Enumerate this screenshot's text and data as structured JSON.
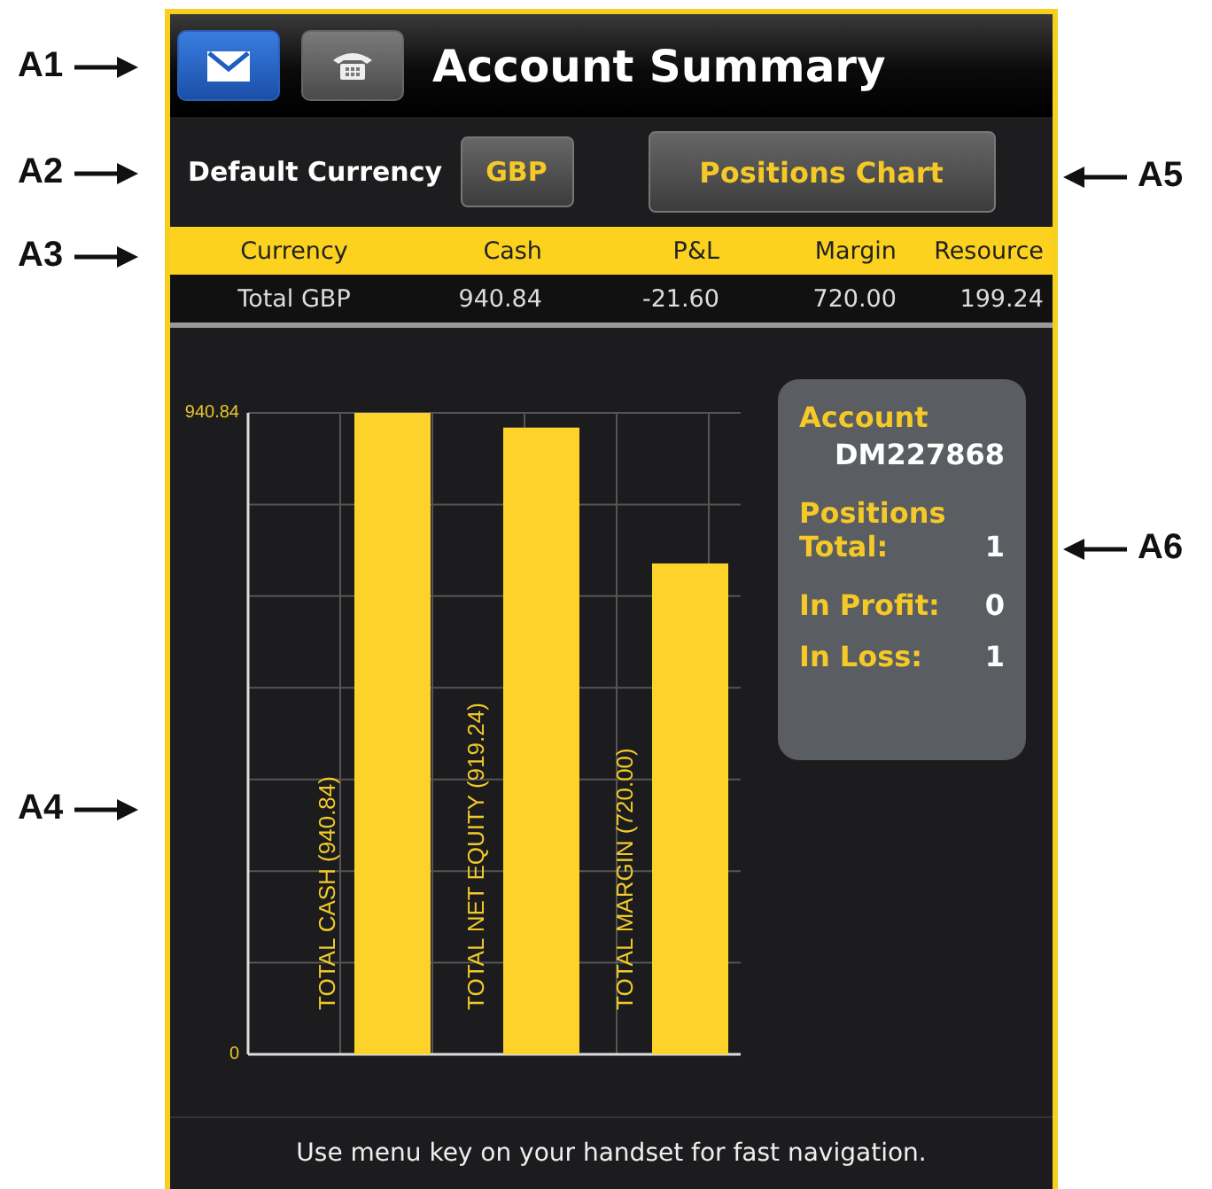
{
  "callouts_left": [
    "A1",
    "A2",
    "A3",
    "A4"
  ],
  "callouts_right": [
    "A5",
    "A6"
  ],
  "header": {
    "title": "Account Summary",
    "buttons": [
      {
        "kind": "mail",
        "selected": true
      },
      {
        "kind": "phone",
        "selected": false
      }
    ]
  },
  "currency_bar": {
    "label": "Default Currency",
    "currency_button": "GBP",
    "chart_button": "Positions Chart"
  },
  "table": {
    "columns": [
      "Currency",
      "Cash",
      "P&L",
      "Margin",
      "Resource"
    ],
    "rows": [
      [
        "Total GBP",
        "940.84",
        "-21.60",
        "720.00",
        "199.24"
      ]
    ]
  },
  "chart_data": {
    "type": "bar",
    "categories": [
      "TOTAL CASH (940.84)",
      "TOTAL NET EQUITY (919.24)",
      "TOTAL MARGIN (720.00)"
    ],
    "values": [
      940.84,
      919.24,
      720.0
    ],
    "ylim": [
      0,
      940.84
    ],
    "yticks": [
      {
        "value": 0,
        "label": "0"
      },
      {
        "value": 940.84,
        "label": "940.84"
      }
    ]
  },
  "account_card": {
    "account_label": "Account",
    "account_id": "DM227868",
    "positions_label": "Positions",
    "stats": [
      {
        "label": "Total:",
        "value": "1"
      },
      {
        "label": "In Profit:",
        "value": "0"
      },
      {
        "label": "In Loss:",
        "value": "1"
      }
    ]
  },
  "footer": "Use menu key on your handset for fast navigation."
}
